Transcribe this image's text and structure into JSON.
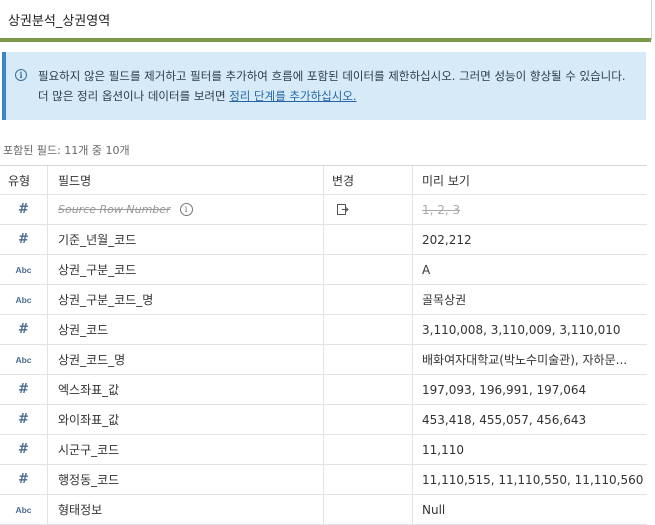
{
  "header": {
    "title": "상권분석_상권영역"
  },
  "info": {
    "text": "필요하지 않은 필드를 제거하고 필터를 추가하여 흐름에 포함된 데이터를 제한하십시오. 그러면 성능이 향상될 수 있습니다. 더 많은 정리 옵션이나 데이터를 보려면 ",
    "link": "정리 단계를 추가하십시오."
  },
  "included_label": "포함된 필드: 11개 중 10개",
  "columns": {
    "type": "유형",
    "name": "필드명",
    "change": "변경",
    "preview": "미리 보기"
  },
  "fields": [
    {
      "type": "#",
      "type_icon": "number-icon",
      "name": "Source Row Number",
      "preview": "1, 2, 3",
      "removed": true
    },
    {
      "type": "#",
      "type_icon": "number-icon",
      "name": "기준_년월_코드",
      "preview": "202,212"
    },
    {
      "type": "Abc",
      "type_icon": "string-icon",
      "name": "상권_구분_코드",
      "preview": "A"
    },
    {
      "type": "Abc",
      "type_icon": "string-icon",
      "name": "상권_구분_코드_명",
      "preview": "골목상권"
    },
    {
      "type": "#",
      "type_icon": "number-icon",
      "name": "상권_코드",
      "preview": "3,110,008, 3,110,009, 3,110,010"
    },
    {
      "type": "Abc",
      "type_icon": "string-icon",
      "name": "상권_코드_명",
      "preview": "배화여자대학교(박노수미술관), 자하문..."
    },
    {
      "type": "#",
      "type_icon": "number-icon",
      "name": "엑스좌표_값",
      "preview": "197,093, 196,991, 197,064"
    },
    {
      "type": "#",
      "type_icon": "number-icon",
      "name": "와이좌표_값",
      "preview": "453,418, 455,057, 456,643"
    },
    {
      "type": "#",
      "type_icon": "number-icon",
      "name": "시군구_코드",
      "preview": "11,110"
    },
    {
      "type": "#",
      "type_icon": "number-icon",
      "name": "행정동_코드",
      "preview": "11,110,515, 11,110,550, 11,110,560"
    },
    {
      "type": "Abc",
      "type_icon": "string-icon",
      "name": "형태정보",
      "preview": "Null"
    }
  ],
  "colors": {
    "accent_bar": "#7a9a4a",
    "info_bg": "#d6ebf7",
    "info_border": "#3a86c8",
    "type_icon": "#4a6d91"
  }
}
